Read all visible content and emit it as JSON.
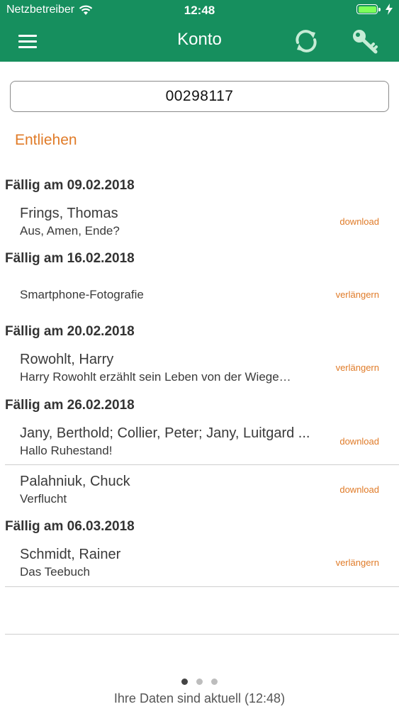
{
  "status_bar": {
    "carrier": "Netzbetreiber",
    "time": "12:48"
  },
  "nav": {
    "title": "Konto",
    "menu_icon": "hamburger-icon",
    "sync_icon": "sync-icon",
    "key_icon": "key-icon"
  },
  "account": {
    "number": "00298117"
  },
  "section": {
    "label": "Entliehen"
  },
  "groups": [
    {
      "due": "Fällig am 09.02.2018",
      "items": [
        {
          "author": "Frings, Thomas",
          "title": "Aus, Amen, Ende?",
          "action": "download"
        }
      ]
    },
    {
      "due": "Fällig am 16.02.2018",
      "items": [
        {
          "author": "",
          "title": "Smartphone-Fotografie",
          "action": "verlängern"
        }
      ]
    },
    {
      "due": "Fällig am 20.02.2018",
      "items": [
        {
          "author": "Rowohlt, Harry",
          "title": "Harry Rowohlt erzählt sein Leben von der Wiege…",
          "action": "verlängern"
        }
      ]
    },
    {
      "due": "Fällig am 26.02.2018",
      "items": [
        {
          "author": "Jany, Berthold; Collier, Peter; Jany, Luitgard ...",
          "title": "Hallo Ruhestand!",
          "action": "download"
        },
        {
          "author": "Palahniuk, Chuck",
          "title": "Verflucht",
          "action": "download"
        }
      ]
    },
    {
      "due": "Fällig am 06.03.2018",
      "items": [
        {
          "author": "Schmidt, Rainer",
          "title": "Das Teebuch",
          "action": "verlängern"
        }
      ]
    }
  ],
  "pager": {
    "count": 3,
    "active": 1
  },
  "footer": {
    "text": "Ihre Daten sind aktuell (12:48)"
  },
  "colors": {
    "header": "#168f5e",
    "accent": "#e07b28"
  }
}
